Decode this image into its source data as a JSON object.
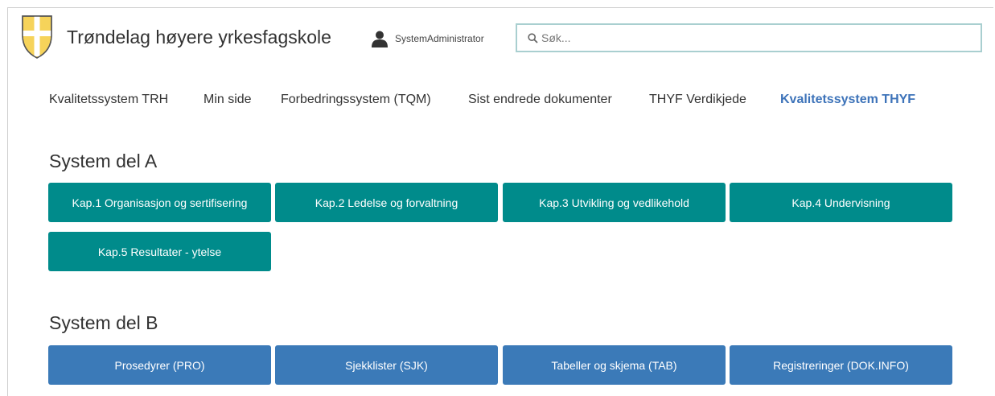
{
  "header": {
    "school_name": "Trøndelag høyere yrkesfagskole",
    "logo_icon": "coat-of-arms-icon",
    "user_name": "SystemAdministrator",
    "search": {
      "placeholder": "Søk...",
      "value": ""
    }
  },
  "nav": {
    "items": [
      {
        "label": "Kvalitetssystem TRH",
        "active": false
      },
      {
        "label": "Min side",
        "active": false
      },
      {
        "label": "Forbedringssystem (TQM)",
        "active": false
      },
      {
        "label": "Sist endrede dokumenter",
        "active": false
      },
      {
        "label": "THYF Verdikjede",
        "active": false
      },
      {
        "label": "Kvalitetssystem THYF",
        "active": true
      }
    ]
  },
  "sections": [
    {
      "title": "System del A",
      "color": "#008b8b",
      "tiles": [
        "Kap.1 Organisasjon og sertifisering",
        "Kap.2 Ledelse og forvaltning",
        "Kap.3 Utvikling og vedlikehold",
        "Kap.4 Undervisning",
        "Kap.5 Resultater - ytelse"
      ]
    },
    {
      "title": "System del B",
      "color": "#3b7ab8",
      "tiles": [
        "Prosedyrer (PRO)",
        "Sjekklister (SJK)",
        "Tabeller og skjema (TAB)",
        "Registreringer (DOK.INFO)"
      ]
    }
  ],
  "colors": {
    "active_nav": "#3d73b9",
    "search_border": "#a9cfd0",
    "text": "#333333"
  }
}
